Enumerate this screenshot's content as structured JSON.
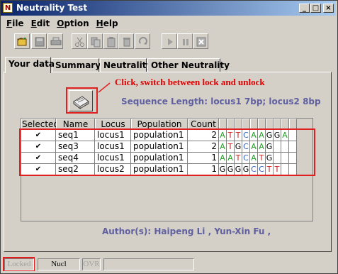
{
  "window": {
    "title": "Neutrality Test",
    "app_icon_glyph": "N"
  },
  "menu": [
    {
      "key": "F",
      "rest": "ile"
    },
    {
      "key": "E",
      "rest": "dit"
    },
    {
      "key": "O",
      "rest": "ption"
    },
    {
      "key": "H",
      "rest": "elp"
    }
  ],
  "toolbar_icons": [
    "open-folder-icon",
    "save-icon",
    "print-icon",
    "cut-icon",
    "copy-icon",
    "paste-icon",
    "delete-icon",
    "redo-icon",
    "run-icon",
    "pause-icon",
    "stop-icon"
  ],
  "tabs": [
    "Your data",
    "Summary",
    "Neutrality",
    "Other Neutrality"
  ],
  "annotation": {
    "text": "Click, switch between lock and unlock",
    "color": "#e00000"
  },
  "sequence_length": "Sequence Length:  locus1 7bp; locus2 8bp",
  "table": {
    "headers": [
      "Selected",
      "Name",
      "Locus",
      "Population",
      "Count"
    ],
    "rows": [
      {
        "selected": "✔",
        "name": "seq1",
        "locus": "locus1",
        "population": "population1",
        "count": "2",
        "nucleotides": [
          "A",
          "T",
          "T",
          "C",
          "A",
          "A",
          "G",
          "G",
          "A"
        ]
      },
      {
        "selected": "✔",
        "name": "seq3",
        "locus": "locus1",
        "population": "population1",
        "count": "2",
        "nucleotides": [
          "A",
          "T",
          "G",
          "C",
          "A",
          "A",
          "G"
        ]
      },
      {
        "selected": "✔",
        "name": "seq4",
        "locus": "locus1",
        "population": "population1",
        "count": "1",
        "nucleotides": [
          "A",
          "A",
          "T",
          "C",
          "A",
          "T",
          "G"
        ]
      },
      {
        "selected": "✔",
        "name": "seq2",
        "locus": "locus2",
        "population": "population1",
        "count": "1",
        "nucleotides": [
          "G",
          "G",
          "G",
          "G",
          "C",
          "C",
          "T",
          "T"
        ]
      }
    ],
    "nucleotide_colors": {
      "A": "#20a020",
      "T": "#d02020",
      "C": "#3060c0",
      "G": "#000000"
    }
  },
  "authors": "Author(s): Haipeng Li , Yun-Xin Fu ,",
  "status": {
    "lock": "Locked",
    "mode": "Nucl",
    "ovr": "OVR"
  }
}
